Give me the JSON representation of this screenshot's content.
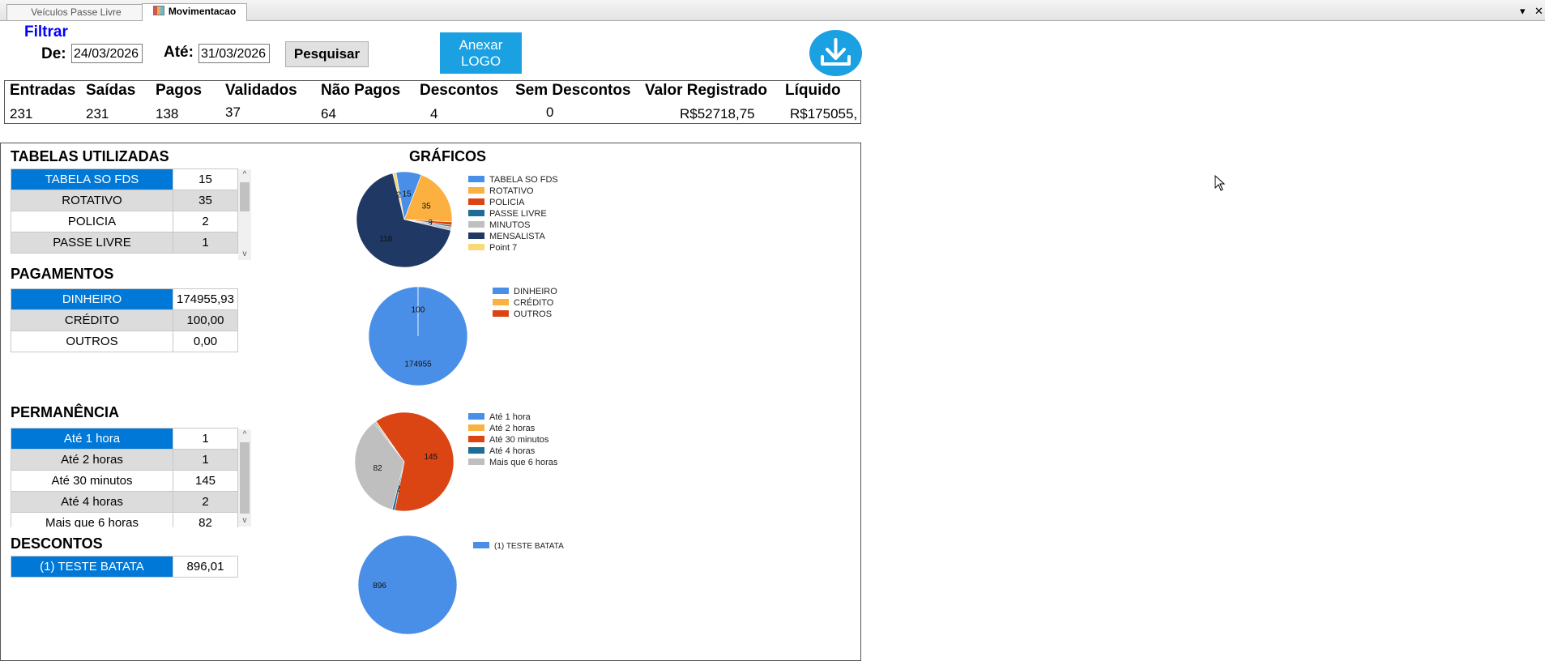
{
  "tabs": [
    {
      "label": "Veículos Passe Livre"
    },
    {
      "label": "Movimentacao"
    }
  ],
  "filter": {
    "title": "Filtrar",
    "from_label": "De:",
    "from_value": "24/03/2026",
    "to_label": "Até:",
    "to_value": "31/03/2026",
    "search_label": "Pesquisar"
  },
  "logo_button": {
    "line1": "Anexar",
    "line2": "LOGO"
  },
  "summary": {
    "headers": [
      "Entradas",
      "Saídas",
      "Pagos",
      "Validados",
      "Não Pagos",
      "Descontos",
      "Sem Descontos",
      "Valor Registrado",
      "Líquido"
    ],
    "values": [
      "231",
      "231",
      "138",
      "37",
      "64",
      "4",
      "0",
      "R$52718,75",
      "R$175055,"
    ]
  },
  "tables_section": {
    "title": "TABELAS UTILIZADAS",
    "rows": [
      {
        "name": "TABELA SO FDS",
        "value": "15"
      },
      {
        "name": "ROTATIVO",
        "value": "35"
      },
      {
        "name": "POLICIA",
        "value": "2"
      },
      {
        "name": "PASSE LIVRE",
        "value": "1"
      }
    ]
  },
  "payments_section": {
    "title": "PAGAMENTOS",
    "rows": [
      {
        "name": "DINHEIRO",
        "value": "174955,93"
      },
      {
        "name": "CRÉDITO",
        "value": "100,00"
      },
      {
        "name": "OUTROS",
        "value": "0,00"
      }
    ]
  },
  "permanence_section": {
    "title": "PERMANÊNCIA",
    "rows": [
      {
        "name": "Até 1 hora",
        "value": "1"
      },
      {
        "name": "Até 2 horas",
        "value": "1"
      },
      {
        "name": "Até 30 minutos",
        "value": "145"
      },
      {
        "name": "Até 4 horas",
        "value": "2"
      },
      {
        "name": "Mais que 6 horas",
        "value": "82"
      }
    ]
  },
  "discounts_section": {
    "title": "DESCONTOS",
    "rows": [
      {
        "name": "(1) TESTE BATATA",
        "value": "896,01"
      }
    ]
  },
  "charts_title": "GRÁFICOS",
  "colors": {
    "accent": "#1ba1e2",
    "selection": "#0078d7",
    "filter_title": "#0000ff"
  },
  "chart_data": [
    {
      "type": "pie",
      "labels": [
        "TABELA SO FDS",
        "ROTATIVO",
        "POLICIA",
        "PASSE LIVRE",
        "MINUTOS",
        "MENSALISTA",
        "Point 7"
      ],
      "values": [
        15,
        35,
        2,
        1,
        2,
        118,
        2
      ],
      "data_labels": [
        "15",
        "35",
        "2",
        "",
        "2",
        "118",
        "2"
      ],
      "colors": [
        "#4a8fe7",
        "#fbb040",
        "#da4513",
        "#1e6d99",
        "#bfbfbf",
        "#1f3864",
        "#f8d978"
      ]
    },
    {
      "type": "pie",
      "labels": [
        "DINHEIRO",
        "CRÉDITO",
        "OUTROS"
      ],
      "values": [
        174955,
        100,
        0
      ],
      "data_labels": [
        "174955",
        "100",
        ""
      ],
      "colors": [
        "#4a8fe7",
        "#fbb040",
        "#da4513"
      ]
    },
    {
      "type": "pie",
      "labels": [
        "Até 1 hora",
        "Até 2 horas",
        "Até 30 minutos",
        "Até 4 horas",
        "Mais que 6 horas"
      ],
      "values": [
        1,
        1,
        145,
        2,
        82
      ],
      "data_labels": [
        "1",
        "",
        "145",
        "2",
        "82"
      ],
      "colors": [
        "#4a8fe7",
        "#fbb040",
        "#da4513",
        "#1e6d99",
        "#bfbfbf"
      ]
    },
    {
      "type": "pie",
      "labels": [
        "(1) TESTE BATATA"
      ],
      "values": [
        896
      ],
      "data_labels": [
        "896"
      ],
      "colors": [
        "#4a8fe7"
      ]
    }
  ]
}
